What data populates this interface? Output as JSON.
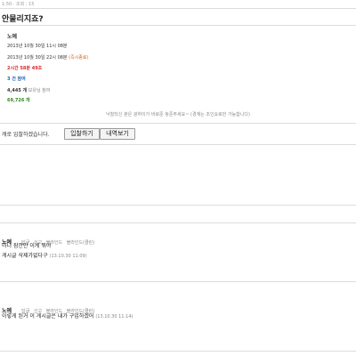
{
  "header": {
    "meta": "1:50 · 조회 : 15",
    "title": "안물리지죠?"
  },
  "info": {
    "author": "노예",
    "start_time": "2013년 10월 30일 11시 08분",
    "end_time": "2013년 10월 30일 22시 08분",
    "end_badge": "(즉시종료)",
    "remaining": "2시간 58분 49초",
    "participants": "3 건 참여",
    "count": "4,445 개",
    "count_suffix": "보유님 참여",
    "points": "69,726 개",
    "notice": "낙찰되신 분은 광하이가 바로준 놓준주세요~ (경계는 조인요로만 가능합니다)"
  },
  "actions": {
    "join_text": "캐로 입찰하겠습니다.",
    "bid_button": "입찰하기",
    "history_button": "내역보기"
  },
  "comments": [
    {
      "user": "노예",
      "links": [
        "답글",
        "신고",
        "블라인드",
        "블라인드(클린)"
      ],
      "lines": [
        "아니 잠깐만 이게 뭐야",
        "게시글 삭제가없다구"
      ],
      "stamp": "(13.10.30 11:09)"
    },
    {
      "user": "노예",
      "links": [
        "답글",
        "신고",
        "블라인드",
        "블라인드(클린)"
      ],
      "lines": [
        "이렇게 된거 이 게시글은 내가 구입하겠어"
      ],
      "stamp": "(13.10.30 11:14)"
    }
  ]
}
